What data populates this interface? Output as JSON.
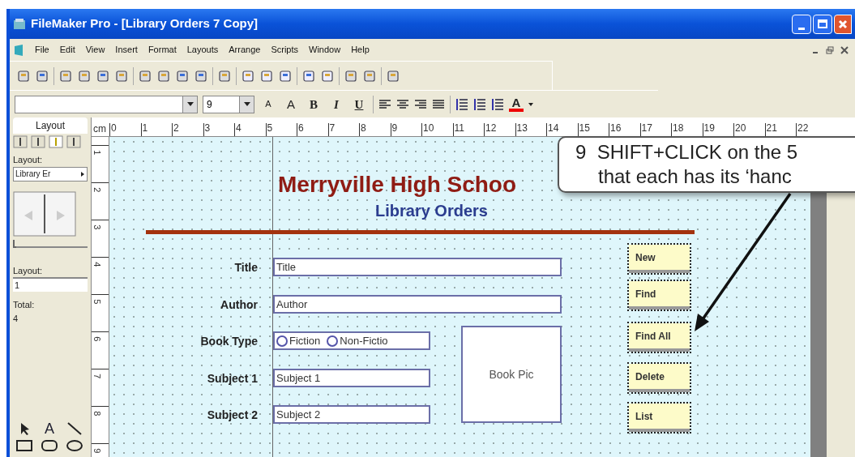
{
  "window": {
    "title": "FileMaker Pro - [Library Orders 7 Copy]"
  },
  "menu": [
    "File",
    "Edit",
    "View",
    "Insert",
    "Format",
    "Layouts",
    "Arrange",
    "Scripts",
    "Window",
    "Help"
  ],
  "format_bar": {
    "size_field": "9",
    "buttons": [
      {
        "label": "A",
        "kind": "shrink"
      },
      {
        "label": "A",
        "kind": "grow"
      },
      {
        "label": "B",
        "kind": "bold"
      },
      {
        "label": "I",
        "kind": "italic"
      },
      {
        "label": "U",
        "kind": "underline"
      }
    ],
    "color_button": "A"
  },
  "status_area": {
    "tab": "Layout",
    "layout_label": "Layout:",
    "layout_menu": "Library Er",
    "slider": {
      "level": 0
    },
    "number_label": "Layout:",
    "number_field": "1",
    "total_label": "Total:",
    "total": "4",
    "text_tool": "A"
  },
  "rulers": {
    "unit": "cm",
    "horizontal": [
      "0",
      "1",
      "2",
      "3",
      "4",
      "5",
      "6",
      "7",
      "8",
      "9",
      "10",
      "11",
      "12",
      "13",
      "14",
      "15",
      "16",
      "17",
      "18",
      "19",
      "20",
      "21",
      "22"
    ],
    "vertical": [
      "1",
      "2",
      "3",
      "4",
      "5",
      "6",
      "7",
      "8",
      "9"
    ]
  },
  "layout": {
    "heading": "Merryville High Schoo",
    "subheading": "Library Orders",
    "fields": [
      {
        "label": "Title",
        "value": "Title",
        "kind": "text"
      },
      {
        "label": "Author",
        "value": "Author",
        "kind": "text"
      },
      {
        "label": "Book Type",
        "kind": "radio",
        "options": [
          "Fiction",
          "Non-Fictio"
        ]
      },
      {
        "label": "Subject 1",
        "value": "Subject 1",
        "kind": "text"
      },
      {
        "label": "Subject 2",
        "value": "Subject 2",
        "kind": "text"
      }
    ],
    "picture_field": "Book Pic",
    "buttons": [
      {
        "label": "New",
        "selected": true
      },
      {
        "label": "Find",
        "selected": true
      },
      {
        "label": "Find All",
        "selected": true
      },
      {
        "label": "Delete",
        "selected": true
      },
      {
        "label": "List",
        "selected": true
      }
    ]
  },
  "callout": {
    "lines": [
      "9  SHIFT+CLICK on the 5",
      "that each has its ‘hanc"
    ]
  }
}
